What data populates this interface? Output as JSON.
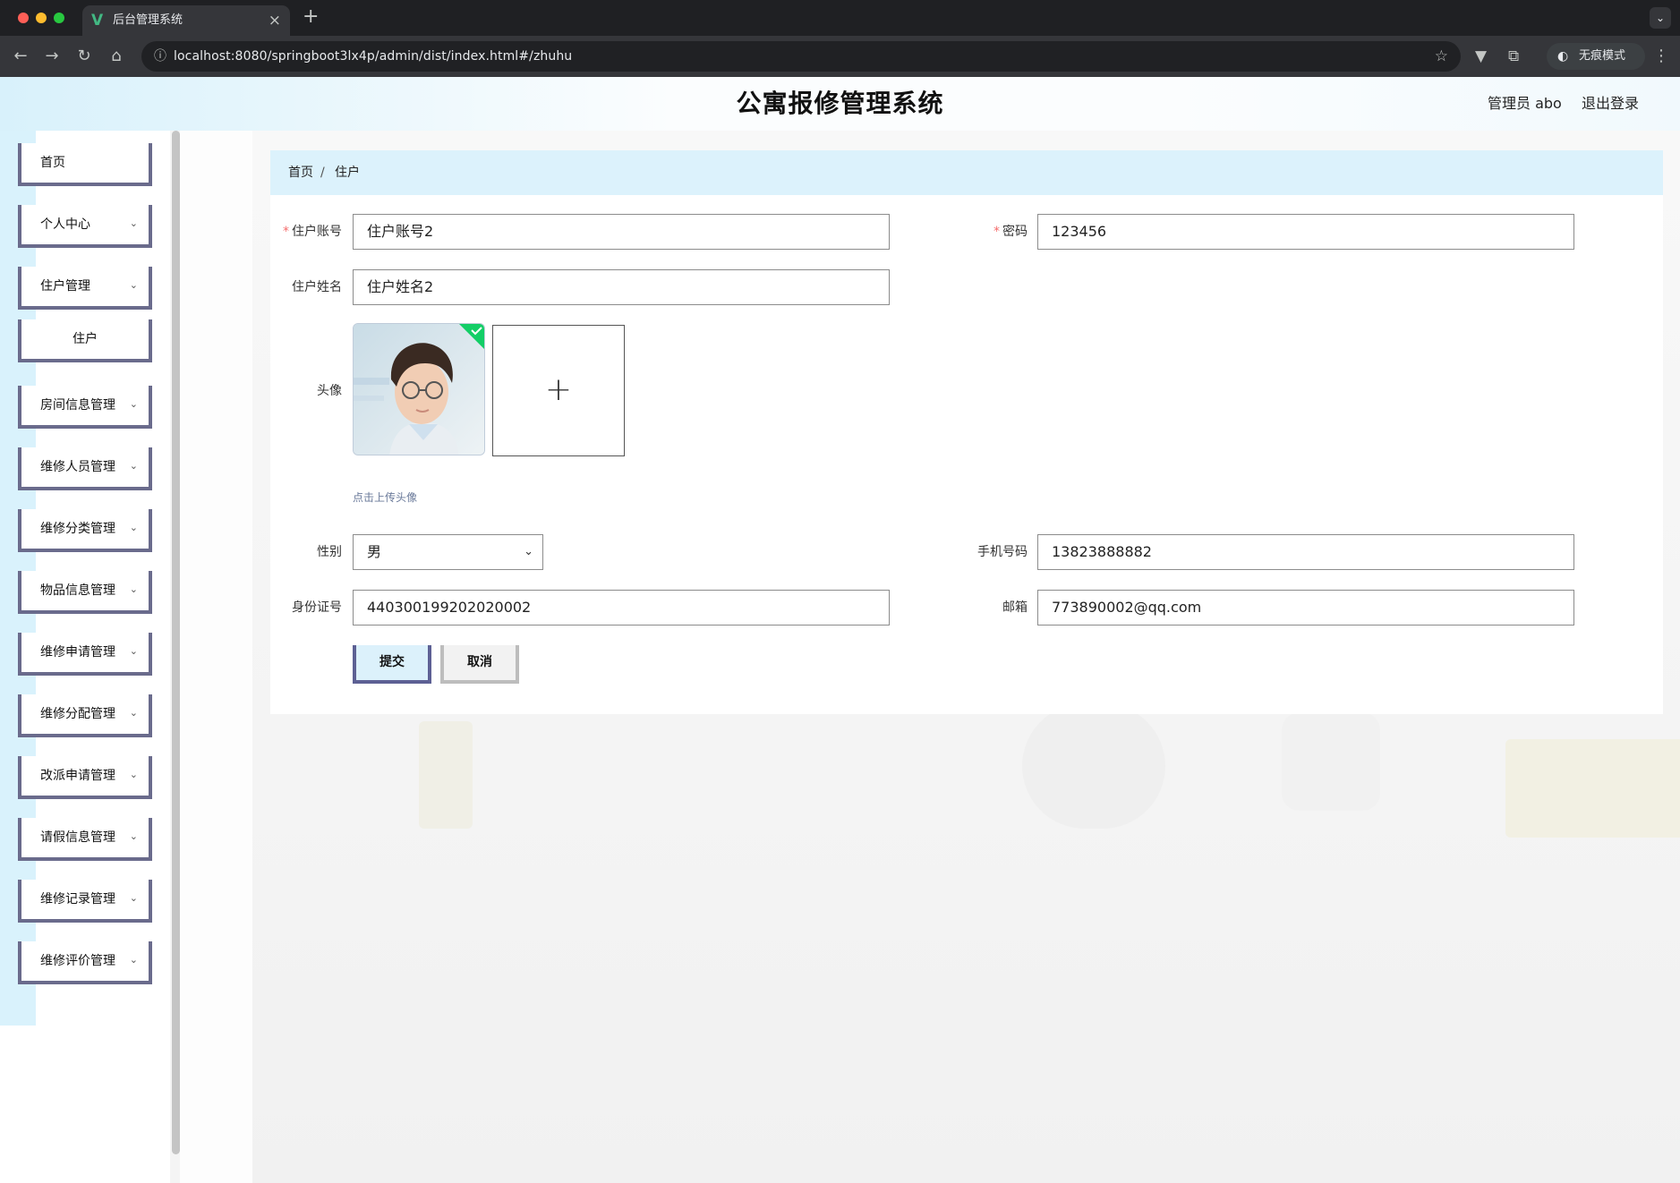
{
  "browser": {
    "tab_title": "后台管理系统",
    "tab_logo": "V",
    "close_glyph": "×",
    "new_tab_glyph": "+",
    "url": "localhost:8080/springboot3lx4p/admin/dist/index.html#/zhuhu",
    "incognito_label": "无痕模式"
  },
  "header": {
    "title": "公寓报修管理系统",
    "user_label": "管理员 abo",
    "logout_label": "退出登录"
  },
  "sidebar": {
    "items": [
      {
        "label": "首页",
        "expandable": false
      },
      {
        "label": "个人中心",
        "expandable": true
      },
      {
        "label": "住户管理",
        "expandable": true
      },
      {
        "label": "住户",
        "expandable": false,
        "submenu": true
      },
      {
        "label": "房间信息管理",
        "expandable": true
      },
      {
        "label": "维修人员管理",
        "expandable": true
      },
      {
        "label": "维修分类管理",
        "expandable": true
      },
      {
        "label": "物品信息管理",
        "expandable": true
      },
      {
        "label": "维修申请管理",
        "expandable": true
      },
      {
        "label": "维修分配管理",
        "expandable": true
      },
      {
        "label": "改派申请管理",
        "expandable": true
      },
      {
        "label": "请假信息管理",
        "expandable": true
      },
      {
        "label": "维修记录管理",
        "expandable": true
      },
      {
        "label": "维修评价管理",
        "expandable": true
      }
    ]
  },
  "breadcrumb": {
    "home": "首页",
    "separator": "/",
    "current": "住户"
  },
  "form": {
    "account": {
      "label": "住户账号",
      "value": "住户账号2",
      "required": true
    },
    "password": {
      "label": "密码",
      "value": "123456",
      "required": true
    },
    "name": {
      "label": "住户姓名",
      "value": "住户姓名2"
    },
    "avatar": {
      "label": "头像",
      "upload_hint": "点击上传头像",
      "plus": "+"
    },
    "gender": {
      "label": "性别",
      "value": "男"
    },
    "phone": {
      "label": "手机号码",
      "value": "13823888882"
    },
    "id_card": {
      "label": "身份证号",
      "value": "440300199202020002"
    },
    "email": {
      "label": "邮箱",
      "value": "773890002@qq.com"
    },
    "submit_label": "提交",
    "cancel_label": "取消"
  },
  "icons": {
    "back": "back-arrow-icon",
    "forward": "forward-arrow-icon",
    "reload": "reload-icon",
    "home": "home-icon",
    "star": "star-icon",
    "chevron": "chevron-down-icon"
  },
  "colors": {
    "menu_border": "#6a6b8c",
    "accent_light": "#dcf2fc",
    "required": "#f56c6c"
  }
}
